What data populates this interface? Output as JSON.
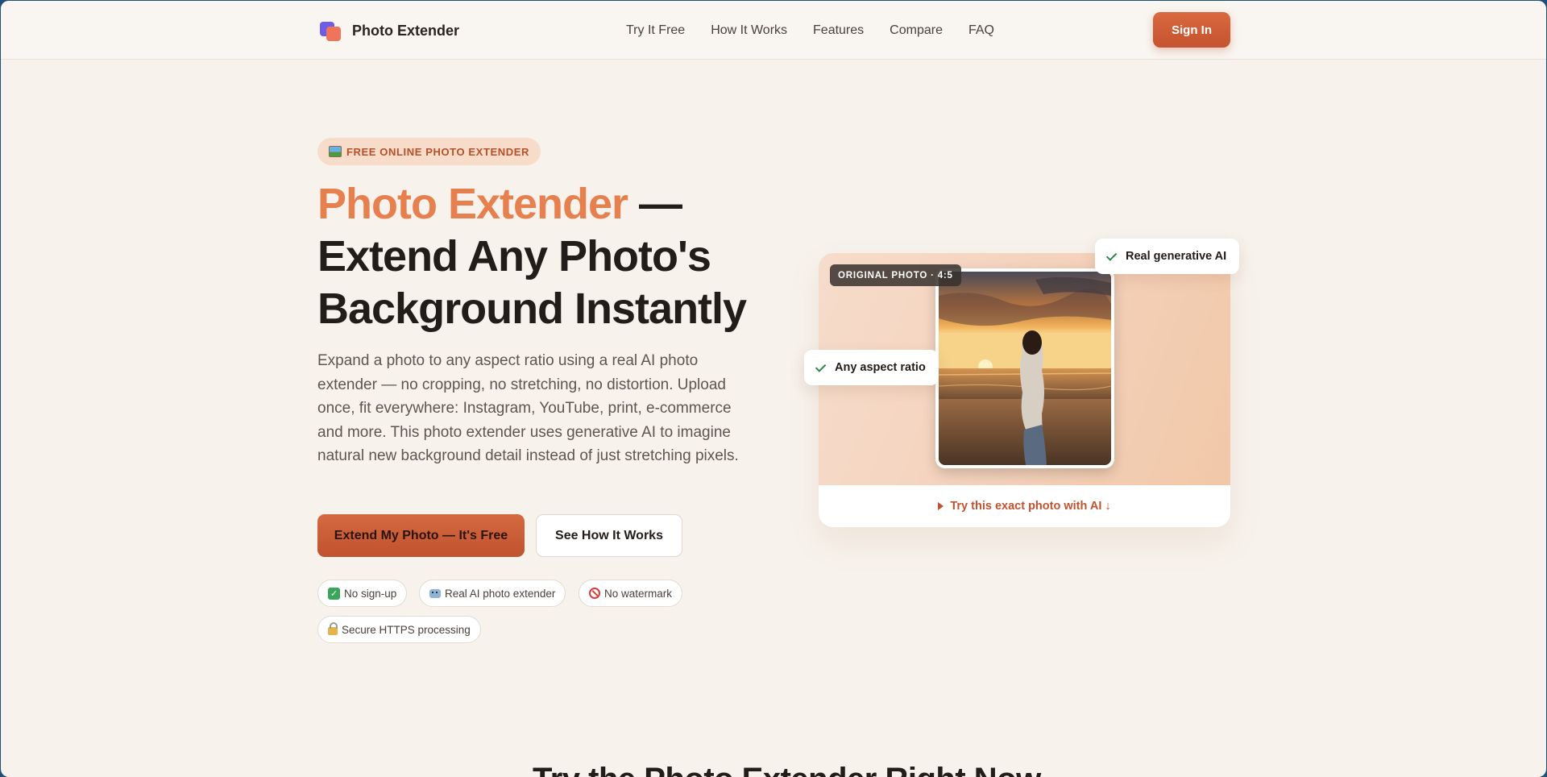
{
  "header": {
    "brand": "Photo Extender",
    "nav": [
      "Try It Free",
      "How It Works",
      "Features",
      "Compare",
      "FAQ"
    ],
    "signin_label": "Sign In"
  },
  "hero": {
    "eyebrow": "FREE ONLINE PHOTO EXTENDER",
    "title_accent": "Photo Extender",
    "title_rest": " — Extend Any Photo's Background Instantly",
    "description": "Expand a photo to any aspect ratio using a real AI photo extender — no cropping, no stretching, no distortion. Upload once, fit everywhere: Instagram, YouTube, print, e-commerce and more. This photo extender uses generative AI to imagine natural new background detail instead of just stretching pixels.",
    "primary_cta": "Extend My Photo — It's Free",
    "secondary_cta": "See How It Works",
    "chips": [
      "No sign-up",
      "Real AI photo extender",
      "No watermark",
      "Secure HTTPS processing"
    ]
  },
  "card": {
    "badge": "ORIGINAL PHOTO · 4:5",
    "float_top": "Real generative AI",
    "float_left": "Any aspect ratio",
    "footer_link": "Try this exact photo with AI ↓"
  },
  "next_section_title": "Try the Photo Extender Right Now",
  "colors": {
    "accent": "#c0532f",
    "title_accent": "#e6814f",
    "background": "#f7f2ec"
  }
}
